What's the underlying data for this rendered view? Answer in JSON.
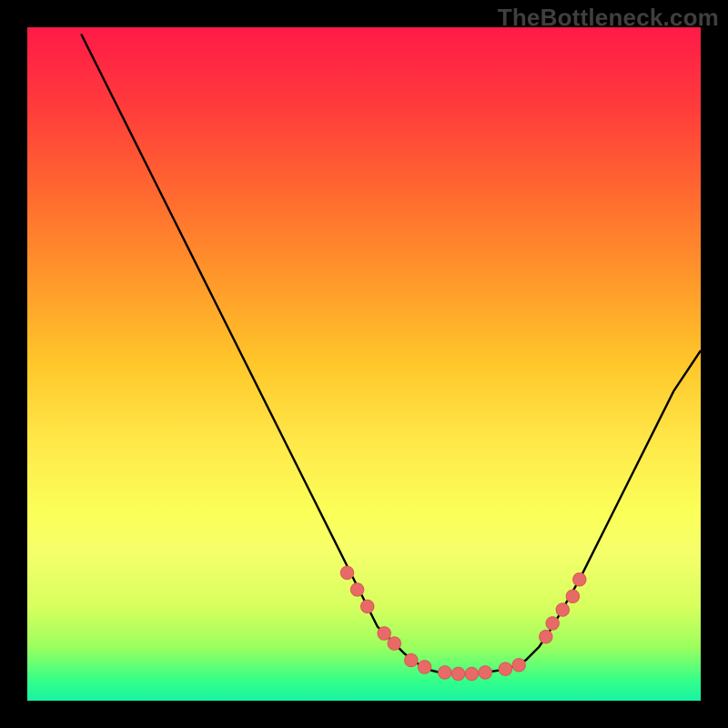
{
  "attribution": "TheBottleneck.com",
  "colors": {
    "curve_stroke": "#000000",
    "dot_fill": "#e86a66",
    "dot_stroke": "#d75955"
  },
  "chart_data": {
    "type": "line",
    "title": "",
    "xlabel": "",
    "ylabel": "",
    "xlim": [
      0,
      100
    ],
    "ylim": [
      0,
      100
    ],
    "x": [
      8,
      10,
      12,
      14,
      16,
      18,
      20,
      22,
      24,
      26,
      28,
      30,
      32,
      34,
      36,
      38,
      40,
      42,
      44,
      46,
      48,
      50,
      52,
      54,
      56,
      58,
      60,
      62,
      64,
      66,
      68,
      70,
      72,
      74,
      76,
      78,
      80,
      82,
      84,
      86,
      88,
      90,
      92,
      94,
      96,
      98,
      100
    ],
    "values": [
      99,
      95,
      91,
      87,
      83,
      79,
      75,
      71,
      67,
      63,
      59,
      55,
      51,
      47,
      43,
      39,
      35,
      31,
      27,
      23,
      19,
      15,
      11,
      9,
      7,
      5.5,
      4.5,
      4,
      4,
      4,
      4.2,
      4.5,
      5,
      6,
      8,
      11,
      14.5,
      18,
      22,
      26,
      30,
      34,
      38,
      42,
      46,
      49,
      52
    ],
    "annotations_dots_x": [
      47.5,
      49,
      50.5,
      53,
      54.5,
      57,
      59,
      62,
      64,
      66,
      68,
      71,
      73,
      77,
      78,
      79.5,
      81,
      82
    ],
    "annotations_dots_y": [
      19,
      16.5,
      14,
      10,
      8.5,
      6,
      5,
      4.2,
      4,
      4,
      4.2,
      4.7,
      5.3,
      9.5,
      11.5,
      13.5,
      15.5,
      18
    ]
  }
}
